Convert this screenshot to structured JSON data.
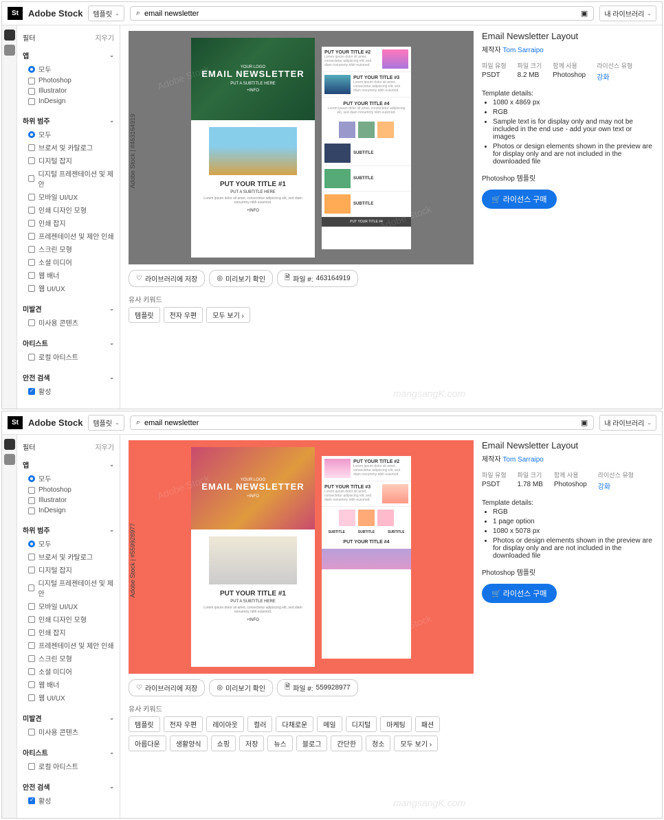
{
  "common": {
    "brand": "Adobe Stock",
    "logo_text": "St",
    "dd_label": "템플릿",
    "search_value": "email newsletter",
    "lib_label": "내 라이브러리",
    "filter_label": "필터",
    "clear_label": "지우기",
    "grp_app": "앱",
    "grp_subcat": "하위 범주",
    "grp_undiscovered": "미발견",
    "grp_artist": "아티스트",
    "grp_safe": "안전 검색",
    "opt_all": "모두",
    "opt_ps": "Photoshop",
    "opt_ai": "Illustrator",
    "opt_id": "InDesign",
    "opt_unused": "미사용 콘텐츠",
    "opt_local": "로컬 아티스트",
    "opt_active": "활성",
    "act_save": "라이브러리에 저장",
    "act_preview": "미리보기 확인",
    "act_file": "파일 #:",
    "kw_label": "유사 키워드",
    "detail_title": "Email Newsletter Layout",
    "detail_author_label": "제작자",
    "detail_author": "Tom Sarraipo",
    "meta_filetype_l": "파일 유형",
    "meta_filesize_l": "파일 크기",
    "meta_app_l": "함께 사용",
    "meta_app_v": "Photoshop",
    "meta_lic_l": "라이선스 유형",
    "meta_lic_v": "강화",
    "tdetails": "Template details:",
    "ps_template": "Photoshop 템플릿",
    "buy": "라이선스 구매",
    "hero_logo": "YOUR LOGO",
    "hero_title": "EMAIL NEWSLETTER",
    "hero_sub": "PUT A SUBTITLE HERE",
    "hero_info": "+INFO",
    "t1": "PUT YOUR TITLE #1",
    "t1_sub": "PUT A SUBTITLE HERE",
    "lorem": "Lorem ipsum dolor sit amet, consectetur adipiscing elit, sed diam nonummy nibh euismod.",
    "row2": "PUT YOUR TITLE #2",
    "row3": "PUT YOUR TITLE #3",
    "row4": "PUT YOUR TITLE #4",
    "sub_s": "SUBTITLE",
    "site_wm": "mangsangK.com"
  },
  "p1": {
    "subcats": [
      "브로서 및 카탈로그",
      "디지털 잡지",
      "디지털 프레젠테이션 및 제안",
      "모바일 UI/UX",
      "인쇄 디자인 모형",
      "인쇄 잡지",
      "프레젠테이션 및 제안 인쇄",
      "스크린 모형",
      "소셜 미디어",
      "웹 배너",
      "웹 UI/UX"
    ],
    "file_id": "463164919",
    "vt": "Adobe Stock | #463164919",
    "meta_filetype_v": "PSDT",
    "meta_filesize_v": "8.2 MB",
    "bullets": [
      "1080 x 4869 px",
      "RGB",
      "Sample text is for display only and may not be included in the end use - add your own text or images",
      "Photos or design elements shown in the preview are for display only and are not included in the downloaded file"
    ],
    "tags": [
      "템플릿",
      "전자 우편",
      "모두 보기 ›"
    ]
  },
  "p2": {
    "subcats": [
      "브로서 및 카탈로그",
      "디지털 잡지",
      "디지털 프레젠테이션 및 제안",
      "모바일 UI/UX",
      "인쇄 디자인 모형",
      "인쇄 잡지",
      "프레젠테이션 및 제안 인쇄",
      "스크린 모형",
      "소셜 미디어",
      "웹 배너",
      "웹 UI/UX"
    ],
    "file_id": "559928977",
    "vt": "Adobe Stock | #559928977",
    "meta_filetype_v": "PSDT",
    "meta_filesize_v": "1.78 MB",
    "bullets": [
      "RGB",
      "1 page option",
      "1080 x 5078 px",
      "Photos or design elements shown in the preview are for display only and are not included in the downloaded file"
    ],
    "tags": [
      "템플릿",
      "전자 우편",
      "레이아웃",
      "컬러",
      "다채로운",
      "메일",
      "디지털",
      "마케팅",
      "패션",
      "아름다운",
      "생활양식",
      "쇼핑",
      "저장",
      "뉴스",
      "블로그",
      "간단한",
      "청소",
      "모두 보기 ›"
    ]
  }
}
